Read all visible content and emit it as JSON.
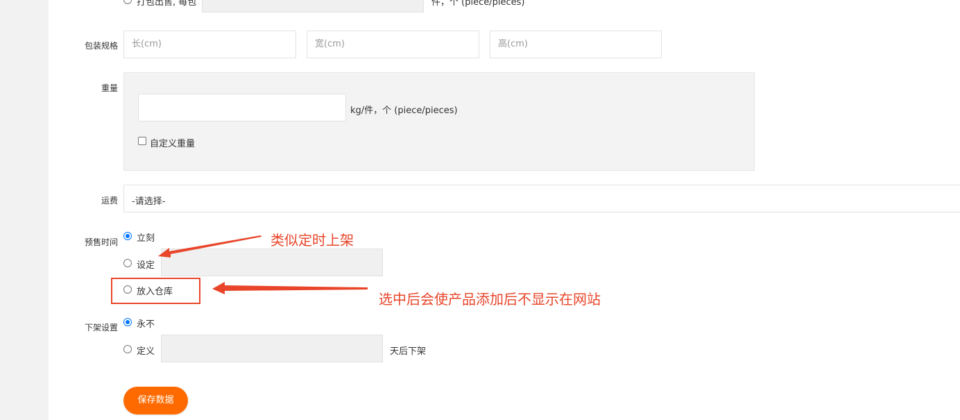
{
  "top_row": {
    "option_label": "打包出售, 每包",
    "unit_label": "件，个 (piece/pieces)"
  },
  "package": {
    "label": "包装规格",
    "length_placeholder": "长(cm)",
    "width_placeholder": "宽(cm)",
    "height_placeholder": "高(cm)"
  },
  "weight": {
    "label": "重量",
    "value": "",
    "unit": "kg/件，个 (piece/pieces)",
    "custom_label": "自定义重量"
  },
  "shipping": {
    "label": "运费",
    "selected": "-请选择-"
  },
  "presale": {
    "label": "预售时间",
    "options": [
      "立刻",
      "设定",
      "放入仓库"
    ],
    "selected_index": 0
  },
  "offshelf": {
    "label": "下架设置",
    "options": [
      "永不",
      "定义"
    ],
    "selected_index": 0,
    "suffix": "天后下架"
  },
  "save_button": "保存数据",
  "annotations": {
    "timed": "类似定时上架",
    "warehouse": "选中后会使产品添加后不显示在网站",
    "color": "#e8452a"
  },
  "colors": {
    "accent": "#ff6a00",
    "radio_checked": "#0075ff"
  }
}
